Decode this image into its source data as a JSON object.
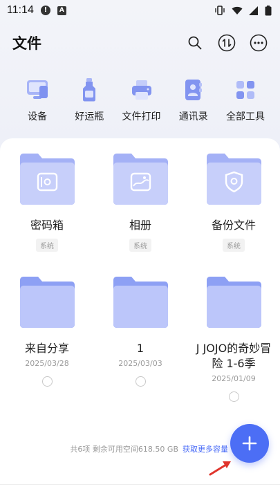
{
  "status_bar": {
    "time": "11:14"
  },
  "header": {
    "title": "文件"
  },
  "tools": [
    {
      "label": "设备",
      "icon": "device-icon"
    },
    {
      "label": "好运瓶",
      "icon": "bottle-icon"
    },
    {
      "label": "文件打印",
      "icon": "printer-icon"
    },
    {
      "label": "通讯录",
      "icon": "contacts-icon"
    },
    {
      "label": "全部工具",
      "icon": "all-tools-icon"
    }
  ],
  "items": [
    {
      "name": "密码箱",
      "tag": "系统",
      "icon": "safe-icon"
    },
    {
      "name": "相册",
      "tag": "系统",
      "icon": "album-icon"
    },
    {
      "name": "备份文件",
      "tag": "系统",
      "icon": "shield-icon"
    },
    {
      "name": "来自分享",
      "date": "2025/03/28"
    },
    {
      "name": "1",
      "date": "2025/03/03"
    },
    {
      "name": "J JOJO的奇妙冒险 1-6季",
      "date": "2025/01/09"
    }
  ],
  "storage": {
    "summary": "共6项 剩余可用空间618.50 GB",
    "link": "获取更多容量"
  },
  "colors": {
    "accent": "#4c6ef5",
    "folder_light": "#d7dcfb",
    "folder_dark": "#8fa0f3"
  }
}
